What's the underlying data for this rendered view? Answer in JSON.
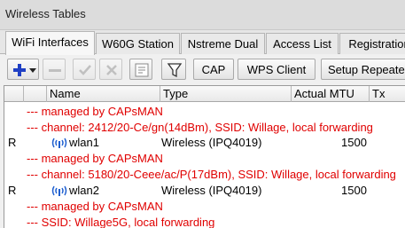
{
  "window": {
    "title": "Wireless Tables"
  },
  "tabs": [
    {
      "label": "WiFi Interfaces",
      "active": true
    },
    {
      "label": "W60G Station"
    },
    {
      "label": "Nstreme Dual"
    },
    {
      "label": "Access List"
    },
    {
      "label": "Registration"
    }
  ],
  "toolbar": {
    "cap_label": "CAP",
    "wps_label": "WPS Client",
    "setup_label": "Setup Repeater"
  },
  "table": {
    "columns": [
      "Name",
      "Type",
      "Actual MTU",
      "Tx"
    ],
    "rows": [
      {
        "kind": "comment",
        "text": "--- managed by CAPsMAN"
      },
      {
        "kind": "comment",
        "text": "--- channel: 2412/20-Ce/gn(14dBm), SSID: Willage, local forwarding"
      },
      {
        "kind": "data",
        "flag": "R",
        "name": "wlan1",
        "type": "Wireless (IPQ4019)",
        "mtu": "1500"
      },
      {
        "kind": "comment",
        "text": "--- managed by CAPsMAN"
      },
      {
        "kind": "comment",
        "text": "--- channel: 5180/20-Ceee/ac/P(17dBm), SSID: Willage, local forwarding"
      },
      {
        "kind": "data",
        "flag": "R",
        "name": "wlan2",
        "type": "Wireless (IPQ4019)",
        "mtu": "1500"
      },
      {
        "kind": "comment",
        "text": "--- managed by CAPsMAN"
      },
      {
        "kind": "comment",
        "text": "--- SSID: Willage5G, local forwarding"
      }
    ]
  },
  "colors": {
    "comment": "#e00000",
    "add_icon": "#1f3fc4",
    "wlan_icon": "#2060d0"
  }
}
